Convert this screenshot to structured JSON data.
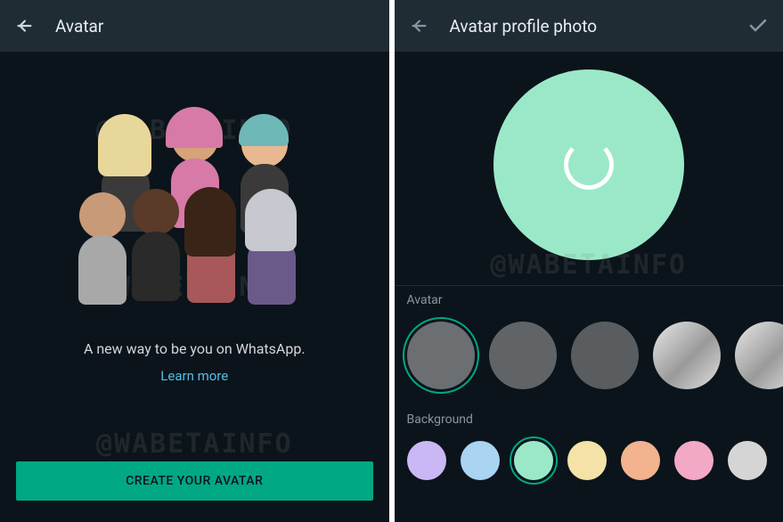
{
  "left": {
    "title": "Avatar",
    "tagline": "A new way to be you on WhatsApp.",
    "learn_more": "Learn more",
    "cta": "CREATE YOUR AVATAR",
    "watermark": "@WABETAINFO"
  },
  "right": {
    "title": "Avatar profile photo",
    "preview_bg": "#9be8c9",
    "sections": {
      "avatar_label": "Avatar",
      "background_label": "Background"
    },
    "avatar_swatches": [
      {
        "color": "#6b6f72",
        "selected": true
      },
      {
        "color": "#616467",
        "selected": false
      },
      {
        "color": "#595d60",
        "selected": false
      },
      {
        "color": "gradient",
        "selected": false
      },
      {
        "color": "gradient",
        "selected": false
      }
    ],
    "background_swatches": [
      {
        "color": "#c9b8f5",
        "selected": false
      },
      {
        "color": "#a9d4f2",
        "selected": false
      },
      {
        "color": "#9be8c9",
        "selected": true
      },
      {
        "color": "#f5e2a8",
        "selected": false
      },
      {
        "color": "#f2b38e",
        "selected": false
      },
      {
        "color": "#f2a9c6",
        "selected": false
      },
      {
        "color": "#d5d5d5",
        "selected": false
      }
    ],
    "watermark": "@WABETAINFO"
  }
}
